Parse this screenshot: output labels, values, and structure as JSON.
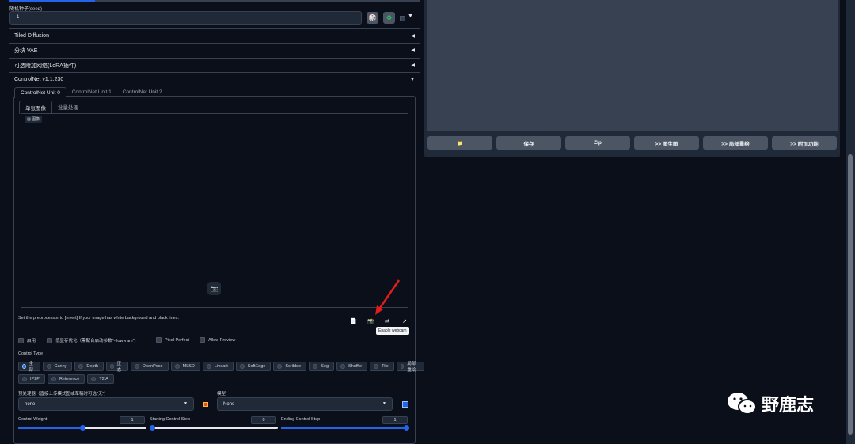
{
  "seed": {
    "label": "随机种子(seed)",
    "value": "-1",
    "dice_icon": "dice-icon",
    "recycle_icon": "recycle-icon"
  },
  "accordions": [
    {
      "label": "Tiled Diffusion",
      "arrow": "◀"
    },
    {
      "label": "分块 VAE",
      "arrow": "◀"
    },
    {
      "label": "可选附加网络(LoRA插件)",
      "arrow": "◀"
    },
    {
      "label": "ControlNet v1.1.230",
      "arrow": "▼"
    }
  ],
  "controlnet": {
    "unit_tabs": [
      "ControlNet Unit 0",
      "ControlNet Unit 1",
      "ControlNet Unit 2"
    ],
    "image_tabs": [
      "单张图像",
      "批量处理"
    ],
    "image_label": "图像",
    "hint": "Set the preprocessor to [invert] If your image has white background and black lines.",
    "tooltip": "Enable webcam",
    "checkboxes": [
      "启用",
      "低显存优化（需配合启动参数\"--lowvram\"）",
      "Pixel Perfect",
      "Allow Preview"
    ],
    "control_type_label": "Control Type",
    "control_types_row1": [
      "全部",
      "Canny",
      "Depth",
      "正态",
      "OpenPose",
      "MLSD",
      "Lineart",
      "SoftEdge",
      "Scribble",
      "Seg",
      "Shuffle",
      "Tile",
      "局部重绘"
    ],
    "control_types_row2": [
      "IP2P",
      "Reference",
      "T2IA"
    ],
    "selected_type": "全部",
    "preprocessor_label": "预处理器（直接上传模式图或草稿时可选\"无\"）",
    "preprocessor_value": "none",
    "model_label": "模型",
    "model_value": "None",
    "control_weight_label": "Control Weight",
    "control_weight": "1",
    "starting_step_label": "Starting Control Step",
    "starting_step": "0",
    "ending_step_label": "Ending Control Step",
    "ending_step": "1",
    "control_weight_fraction": 0.5,
    "starting_step_fraction": 0.0,
    "ending_step_fraction": 1.0
  },
  "output_buttons": [
    "📁",
    "保存",
    "Zip",
    ">> 图生图",
    ">> 局部重绘",
    ">> 附加功能"
  ],
  "watermark": "野鹿志",
  "colors": {
    "accent": "#2563eb",
    "bg": "#0b0f19",
    "panel": "#1f2937"
  }
}
